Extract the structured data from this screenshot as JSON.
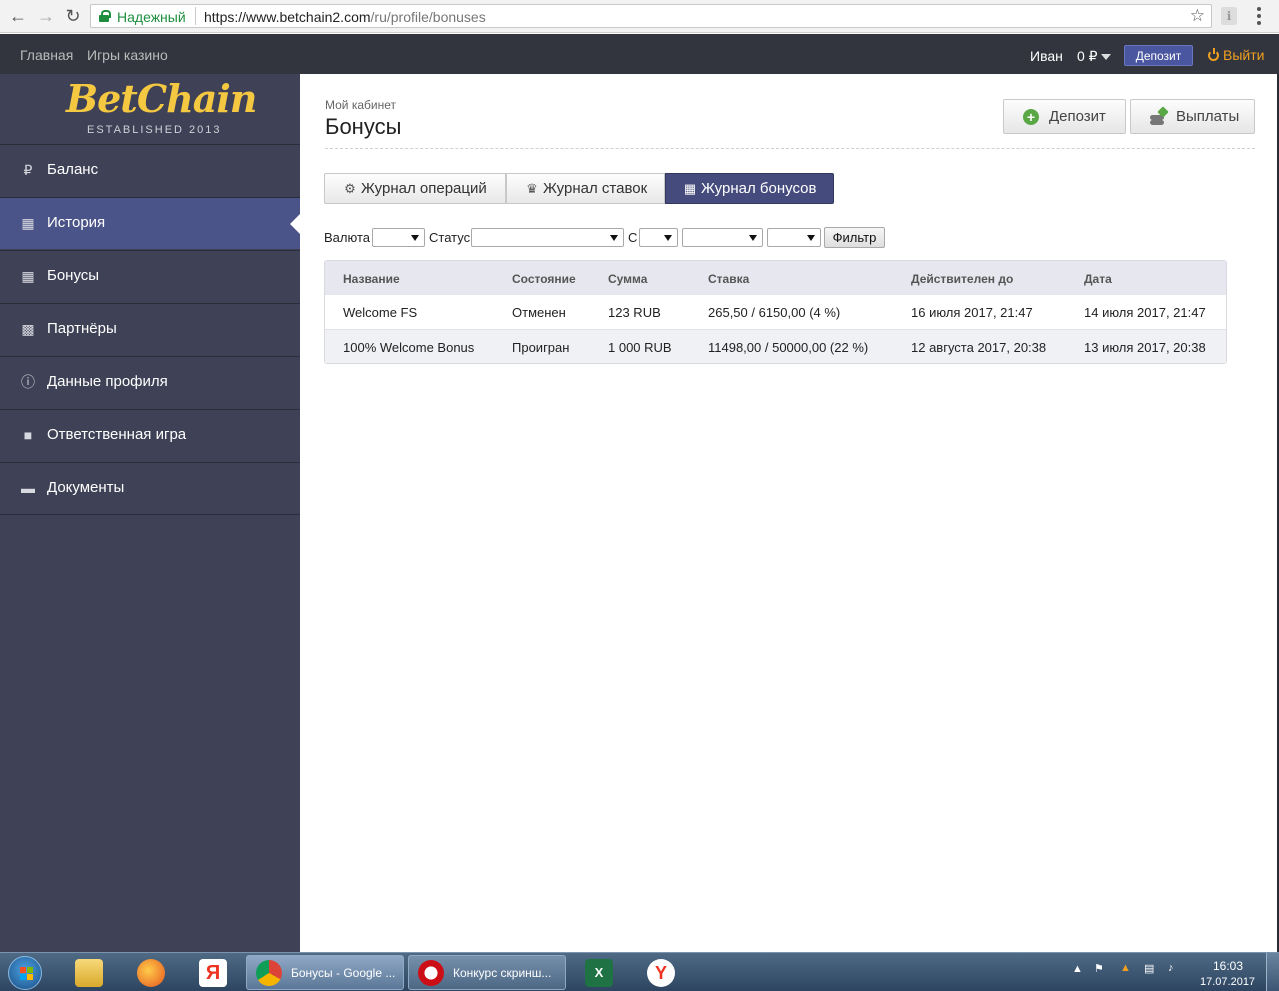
{
  "browser": {
    "secure_label": "Надежный",
    "url_host": "https://www.betchain2.com",
    "url_path": "/ru/profile/bonuses"
  },
  "topbar": {
    "home": "Главная",
    "casino_games": "Игры казино",
    "user_name": "Иван",
    "balance": "0 ₽",
    "deposit": "Депозит",
    "logout": "Выйти"
  },
  "logo": {
    "word": "BetChain",
    "tagline": "ESTABLISHED 2013",
    "color": "#f5c842"
  },
  "sidebar": {
    "items": [
      {
        "label": "Баланс",
        "icon": "ruble-icon"
      },
      {
        "label": "История",
        "icon": "calendar-icon",
        "active": true
      },
      {
        "label": "Бонусы",
        "icon": "gift-icon"
      },
      {
        "label": "Партнёры",
        "icon": "briefcase-icon"
      },
      {
        "label": "Данные профиля",
        "icon": "info-icon"
      },
      {
        "label": "Ответственная игра",
        "icon": "lock-icon"
      },
      {
        "label": "Документы",
        "icon": "folder-icon"
      }
    ]
  },
  "page": {
    "breadcrumb": "Мой кабинет",
    "title": "Бонусы",
    "deposit_button": "Депозит",
    "payouts_button": "Выплаты"
  },
  "tabs": [
    {
      "label": "Журнал операций",
      "icon": "gear-icon"
    },
    {
      "label": "Журнал ставок",
      "icon": "trophy-icon"
    },
    {
      "label": "Журнал бонусов",
      "icon": "gift-icon",
      "active": true
    }
  ],
  "filters": {
    "currency_label": "Валюта",
    "status_label": "Статус",
    "from_label": "С",
    "filter_button": "Фильтр"
  },
  "table": {
    "headers": [
      "Название",
      "Состояние",
      "Сумма",
      "Ставка",
      "Действителен до",
      "Дата"
    ],
    "rows": [
      [
        "Welcome FS",
        "Отменен",
        "123 RUB",
        "265,50 / 6150,00 (4 %)",
        "16 июля 2017, 21:47",
        "14 июля 2017, 21:47"
      ],
      [
        "100% Welcome Bonus",
        "Проигран",
        "1 000 RUB",
        "11498,00 / 50000,00 (22 %)",
        "12 августа 2017, 20:38",
        "13 июля 2017, 20:38"
      ]
    ]
  },
  "taskbar": {
    "tasks": [
      {
        "label": "Бонусы - Google ...",
        "icon": "chrome-icon"
      },
      {
        "label": "Конкурс скринш...",
        "icon": "opera-icon"
      }
    ],
    "time": "16:03",
    "date": "17.07.2017"
  }
}
